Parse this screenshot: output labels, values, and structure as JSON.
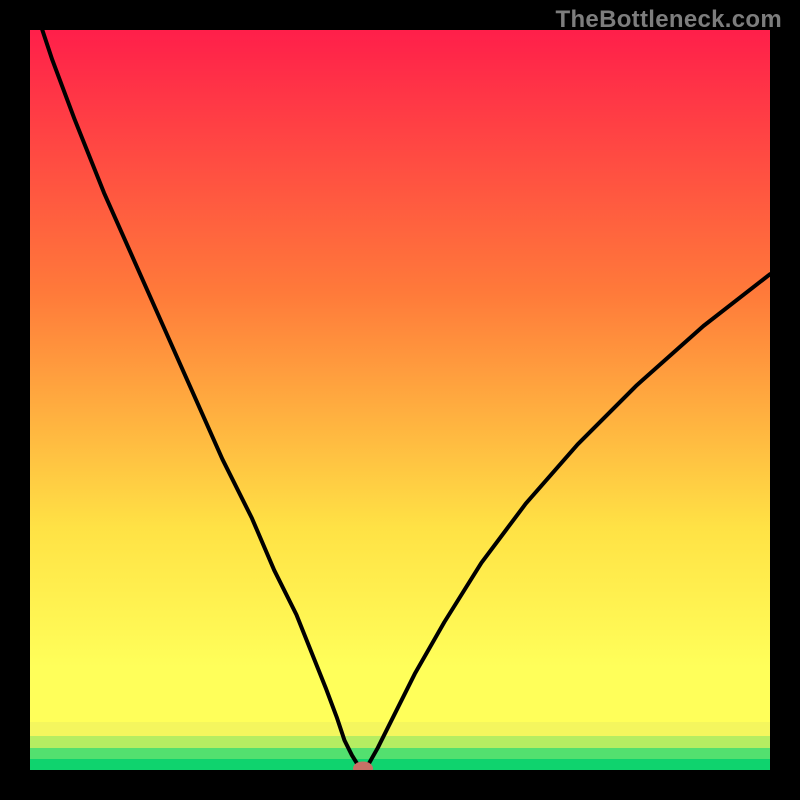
{
  "watermark": "TheBottleneck.com",
  "colors": {
    "frame": "#000000",
    "curve": "#000000",
    "bottom_stripe_1": "#0fd36e",
    "bottom_stripe_2": "#53e06f",
    "bottom_stripe_3": "#b5ed62",
    "bottom_stripe_4": "#f4f65e",
    "marker_fill": "#c77166",
    "gradient_top": "#ff1f4a",
    "gradient_mid1": "#ff7a3a",
    "gradient_mid2": "#ffe245",
    "gradient_bottom": "#ffff5a"
  },
  "chart_data": {
    "type": "line",
    "title": "",
    "xlabel": "",
    "ylabel": "",
    "xlim": [
      0,
      100
    ],
    "ylim": [
      0,
      100
    ],
    "series": [
      {
        "name": "bottleneck-curve",
        "x": [
          0,
          3,
          6,
          10,
          14,
          18,
          22,
          26,
          30,
          33,
          36,
          38,
          40,
          41.5,
          42.5,
          43.5,
          44.3,
          45,
          45.7,
          47,
          49,
          52,
          56,
          61,
          67,
          74,
          82,
          91,
          100
        ],
        "y": [
          105,
          96,
          88,
          78,
          69,
          60,
          51,
          42,
          34,
          27,
          21,
          16,
          11,
          7,
          4,
          2,
          0.7,
          0.2,
          0.7,
          3,
          7,
          13,
          20,
          28,
          36,
          44,
          52,
          60,
          67
        ]
      }
    ],
    "marker": {
      "x": 45,
      "y": 0.2
    },
    "grid": false
  }
}
